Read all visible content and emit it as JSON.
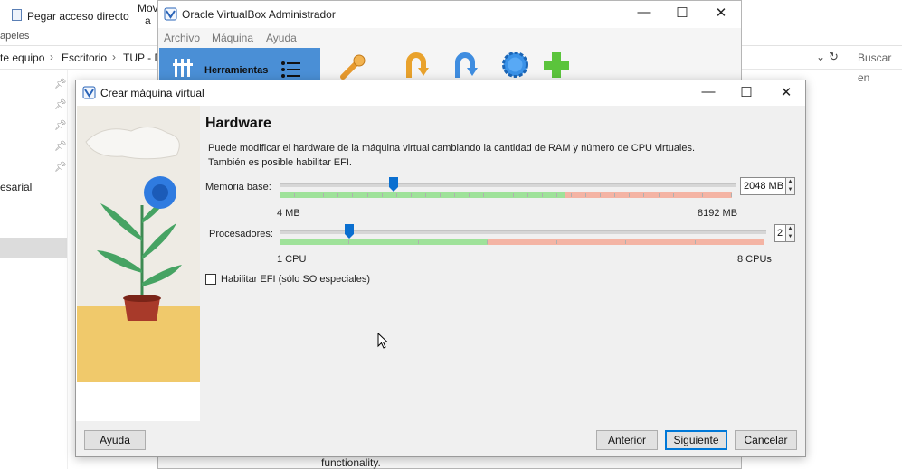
{
  "explorer": {
    "ribbon": {
      "paste_shortcut": "Pegar acceso directo",
      "group_clipboard": "apeles",
      "move_label": "Mov",
      "move_sub": "a"
    },
    "breadcrumb": [
      "te equipo",
      "Escritorio",
      "TUP - D"
    ],
    "search_placeholder": "Buscar en",
    "nav_items": [
      "esarial"
    ]
  },
  "vbox_manager": {
    "title": "Oracle VirtualBox Administrador",
    "menu": [
      "Archivo",
      "Máquina",
      "Ayuda"
    ],
    "tools_label": "Herramientas",
    "behind_text": "functionality."
  },
  "dialog": {
    "title": "Crear máquina virtual",
    "heading": "Hardware",
    "description_line1": "Puede modificar el hardware de la máquina virtual cambiando la cantidad de RAM y número de CPU virtuales.",
    "description_line2": "También es posible habilitar EFI.",
    "memory": {
      "label": "Memoria base:",
      "value": "2048 MB",
      "min_label": "4 MB",
      "max_label": "8192 MB",
      "level": 0.25
    },
    "cpus": {
      "label": "Procesadores:",
      "value": "2",
      "min_label": "1 CPU",
      "max_label": "8 CPUs",
      "level": 0.143
    },
    "efi": {
      "label": "Habilitar EFI (sólo SO especiales)",
      "checked": false
    },
    "buttons": {
      "help": "Ayuda",
      "back": "Anterior",
      "next": "Siguiente",
      "cancel": "Cancelar"
    }
  },
  "colors": {
    "accent": "#0078d7",
    "zone_ok": "#9fe29a",
    "zone_bad": "#f4b4a4",
    "tools_blue": "#4a8fd6"
  },
  "icons": [
    "folder-paste-icon",
    "virtualbox-logo-icon",
    "tools-icon",
    "list-icon",
    "settings-wrench-icon",
    "discard-icon",
    "start-icon",
    "import-gear-icon",
    "add-icon",
    "minimize-icon",
    "maximize-icon",
    "close-icon",
    "pin-icon",
    "refresh-icon",
    "chevron-down-icon",
    "mouse-cursor-icon"
  ]
}
